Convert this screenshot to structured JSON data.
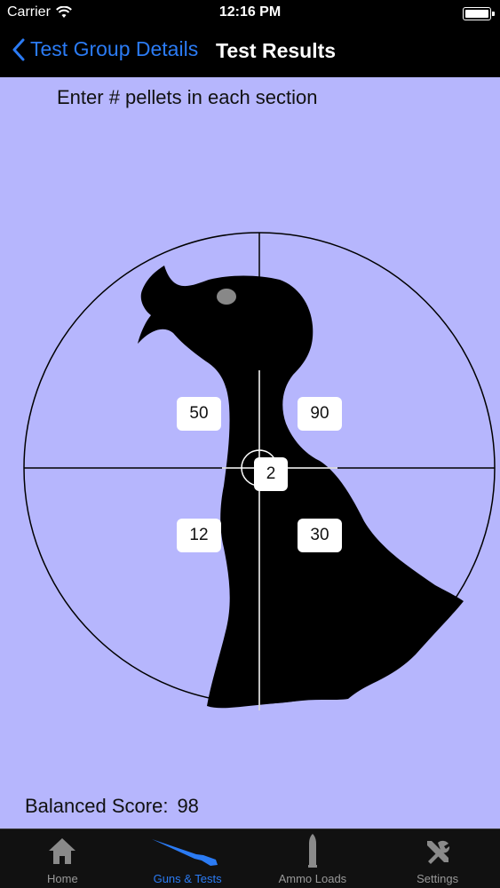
{
  "status": {
    "carrier": "Carrier",
    "time": "12:16 PM"
  },
  "nav": {
    "back_label": "Test Group Details",
    "title": "Test Results"
  },
  "content": {
    "instruction": "Enter # pellets in each section",
    "sections": {
      "upper_left": "50",
      "upper_right": "90",
      "center": "2",
      "lower_left": "12",
      "lower_right": "30"
    },
    "score_label": "Balanced Score:",
    "score_value": "98"
  },
  "tabs": [
    {
      "label": "Home",
      "icon": "home-icon"
    },
    {
      "label": "Guns & Tests",
      "icon": "shotgun-icon",
      "active": true
    },
    {
      "label": "Ammo Loads",
      "icon": "shell-icon"
    },
    {
      "label": "Settings",
      "icon": "tools-icon"
    }
  ],
  "colors": {
    "background": "#b6b6fd",
    "accent": "#2b7bf4",
    "bar": "#000000"
  }
}
